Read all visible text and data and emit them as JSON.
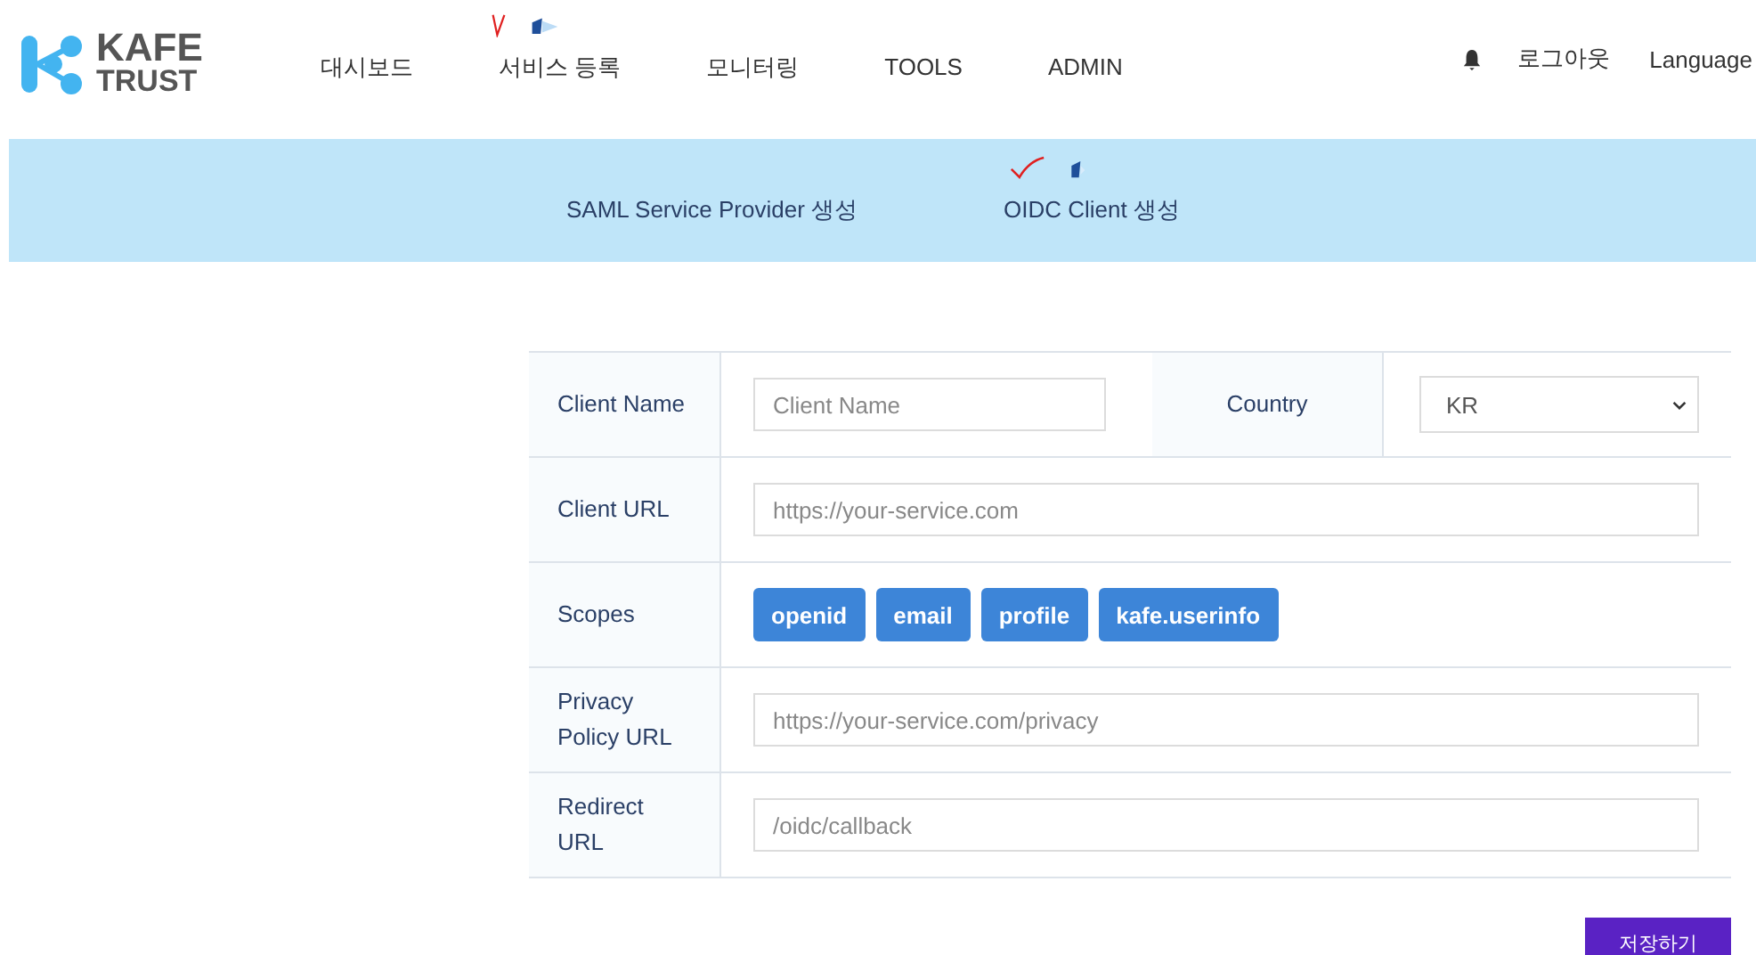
{
  "header": {
    "logo": {
      "line1": "KAFE",
      "line2": "TRUST"
    },
    "nav": [
      {
        "label": "대시보드",
        "marked": false
      },
      {
        "label": "서비스 등록",
        "marked": true
      },
      {
        "label": "모니터링",
        "marked": false
      },
      {
        "label": "TOOLS",
        "marked": false
      },
      {
        "label": "ADMIN",
        "marked": false
      }
    ],
    "logout": "로그아웃",
    "language": "Language"
  },
  "subnav": [
    {
      "label": "SAML Service Provider 생성",
      "marked": false
    },
    {
      "label": "OIDC Client 생성",
      "marked": true
    }
  ],
  "form": {
    "rows": [
      {
        "kind": "name_country",
        "label": "Client Name",
        "placeholder": "Client Name",
        "country_label": "Country",
        "country_value": "KR"
      },
      {
        "kind": "input",
        "label": "Client URL",
        "placeholder": "https://your-service.com"
      },
      {
        "kind": "scopes",
        "label": "Scopes",
        "scopes": [
          "openid",
          "email",
          "profile",
          "kafe.userinfo"
        ]
      },
      {
        "kind": "input",
        "label": "Privacy Policy URL",
        "placeholder": "https://your-service.com/privacy"
      },
      {
        "kind": "input",
        "label": "Redirect URL",
        "placeholder": "/oidc/callback"
      }
    ],
    "save": "저장하기"
  }
}
